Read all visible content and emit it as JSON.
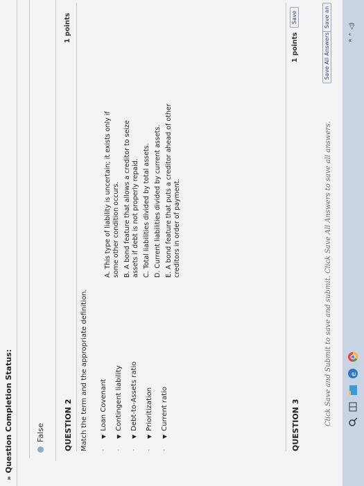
{
  "header": {
    "status_label": "Question Completion Status:"
  },
  "question1": {
    "answer": "False"
  },
  "question2": {
    "title": "QUESTION 2",
    "points": "1 points",
    "instructions": "Match the term and the appropriate definition.",
    "terms": [
      {
        "selected": "-",
        "label": "Loan Covenant"
      },
      {
        "selected": "-",
        "label": "Contingent liability"
      },
      {
        "selected": "-",
        "label": "Debt-to-Assets ratio"
      },
      {
        "selected": "-",
        "label": "Prioritization"
      },
      {
        "selected": "-",
        "label": "Current ratio"
      }
    ],
    "definitions": [
      "A. This type of liability is uncertain; it exists only if some other condition occurs.",
      "B. A bond feature that allows a creditor to seize assets if debt is not properly repaid.",
      "C. Total liabilities divided by total assets.",
      "D. Current liabilities divided by current assets.",
      "E. A bond feature that puts a creditor ahead of other creditors in order of payment."
    ]
  },
  "question3": {
    "title": "QUESTION 3",
    "points": "1 points",
    "save_label": "Save"
  },
  "footer": {
    "instructions": "Click Save and Submit to save and submit. Click Save All Answers to save all answers.",
    "save_all_label": "Save All Answers",
    "save_submit_label": "Save an"
  }
}
